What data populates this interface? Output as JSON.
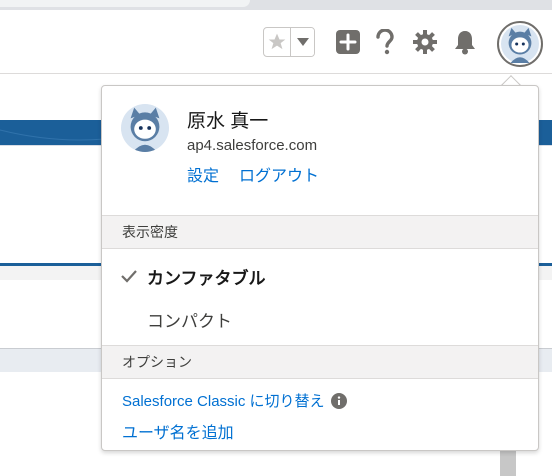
{
  "header": {
    "favorites_star": "star-icon",
    "favorites_dropdown": "caret-down-icon",
    "icons": [
      "plus-icon",
      "help-icon",
      "gear-icon",
      "bell-icon"
    ],
    "avatar": "user-avatar"
  },
  "user_menu": {
    "name": "原水 真一",
    "org": "ap4.salesforce.com",
    "settings_label": "設定",
    "logout_label": "ログアウト",
    "density": {
      "heading": "表示密度",
      "options": [
        {
          "label": "カンファタブル",
          "selected": true
        },
        {
          "label": "コンパクト",
          "selected": false
        }
      ]
    },
    "options": {
      "heading": "オプション",
      "switch_label": "Salesforce Classic に切り替え",
      "add_user_label": "ユーザ名を追加"
    }
  },
  "colors": {
    "link": "#0070d2",
    "brand_band": "#1b5f99",
    "icon_gray": "#706e6b"
  }
}
